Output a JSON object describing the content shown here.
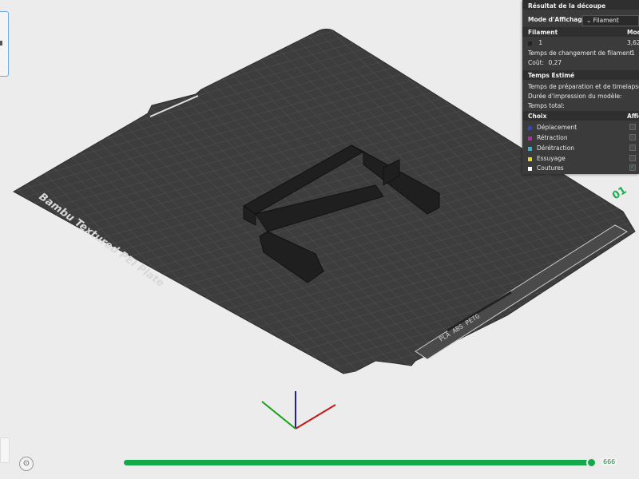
{
  "panel": {
    "title": "Résultat de la découpe",
    "view_mode_label": "Mode d'Affichage",
    "view_mode_value": "Filament",
    "filament_header": "Filament",
    "filament_header_right": "Mod",
    "filament_index": "1",
    "filament_value": "3,62",
    "filament_change_time_label": "Temps de changement de filament:",
    "filament_change_time_value": "1",
    "cost_label": "Coût:",
    "cost_value": "0,27",
    "estimated_time_header": "Temps Estimé",
    "prep_time_label": "Temps de préparation et de timelapse:",
    "print_duration_label": "Durée d'impression du modèle:",
    "total_time_label": "Temps total:",
    "choice_header": "Choix",
    "display_header": "Affic",
    "items": [
      {
        "label": "Déplacement",
        "color": "#3a45b8",
        "checked": false
      },
      {
        "label": "Rétraction",
        "color": "#c020c0",
        "checked": false
      },
      {
        "label": "Dérétraction",
        "color": "#3ab3c8",
        "checked": false
      },
      {
        "label": "Essuyage",
        "color": "#e6e000",
        "checked": false
      },
      {
        "label": "Coutures",
        "color": "#ffffff",
        "checked": true
      }
    ]
  },
  "plate": {
    "brand_text": "Bambu Textured PEI Plate",
    "plate_number": "01",
    "label_text": "PLA ABS PETG"
  },
  "layer_slider": {
    "progress": 1.0,
    "current_layer": "666"
  },
  "colors": {
    "accent": "#13a94b",
    "plate": "#3d3d3d"
  }
}
